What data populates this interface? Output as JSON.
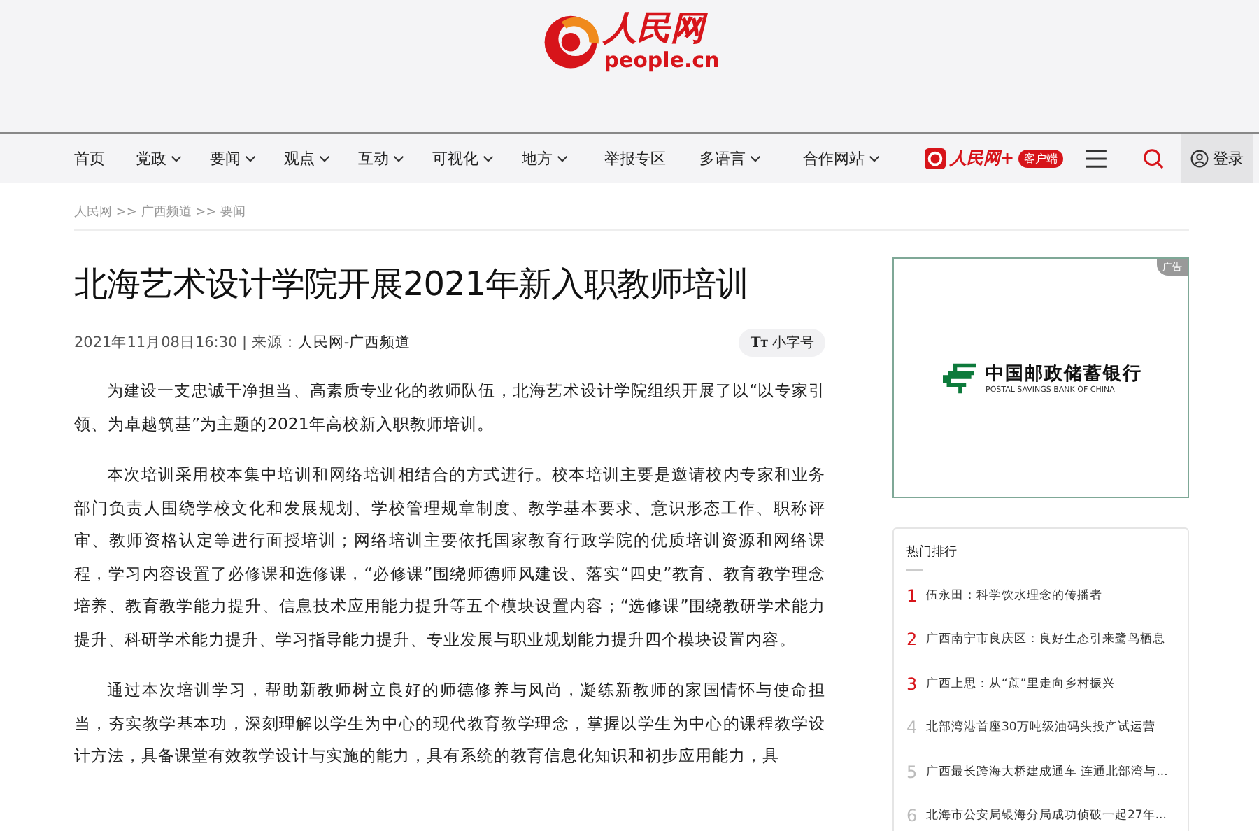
{
  "logo": {
    "name": "人民网",
    "domain": "people.cn"
  },
  "nav": {
    "items": [
      {
        "label": "首页",
        "dropdown": false
      },
      {
        "label": "党政",
        "dropdown": true
      },
      {
        "label": "要闻",
        "dropdown": true
      },
      {
        "label": "观点",
        "dropdown": true
      },
      {
        "label": "互动",
        "dropdown": true
      },
      {
        "label": "可视化",
        "dropdown": true
      },
      {
        "label": "地方",
        "dropdown": true
      },
      {
        "label": "举报专区",
        "dropdown": false
      },
      {
        "label": "多语言",
        "dropdown": true
      },
      {
        "label": "合作网站",
        "dropdown": true
      }
    ],
    "app": {
      "name": "人民网+",
      "badge": "客户端"
    },
    "login": "登录"
  },
  "breadcrumb": "人民网 >> 广西频道 >> 要闻",
  "article": {
    "title": "北海艺术设计学院开展2021年新入职教师培训",
    "meta": "2021年11月08日16:30 | 来源：",
    "source": "人民网-广西频道",
    "font_icon": {
      "big": "T",
      "small": "T"
    },
    "font_button": "小字号",
    "paragraphs": [
      "为建设一支忠诚干净担当、高素质专业化的教师队伍，北海艺术设计学院组织开展了以“以专家引领、为卓越筑基”为主题的2021年高校新入职教师培训。",
      "本次培训采用校本集中培训和网络培训相结合的方式进行。校本培训主要是邀请校内专家和业务部门负责人围绕学校文化和发展规划、学校管理规章制度、教学基本要求、意识形态工作、职称评审、教师资格认定等进行面授培训；网络培训主要依托国家教育行政学院的优质培训资源和网络课程，学习内容设置了必修课和选修课，“必修课”围绕师德师风建设、落实“四史”教育、教育教学理念培养、教育教学能力提升、信息技术应用能力提升等五个模块设置内容；“选修课”围绕教研学术能力提升、科研学术能力提升、学习指导能力提升、专业发展与职业规划能力提升四个模块设置内容。",
      "通过本次培训学习，帮助新教师树立良好的师德修养与风尚，凝练新教师的家国情怀与使命担当，夯实教学基本功，深刻理解以学生为中心的现代教育教学理念，掌握以学生为中心的课程教学设计方法，具备课堂有效教学设计与实施的能力，具有系统的教育信息化知识和初步应用能力，具"
    ]
  },
  "ad": {
    "label": "广告",
    "bank_name": "中国邮政储蓄银行",
    "bank_name_en": "POSTAL SAVINGS BANK OF CHINA"
  },
  "ranking": {
    "title": "热门排行",
    "items": [
      {
        "rank": "1",
        "text": "伍永田：科学饮水理念的传播者",
        "highlighted": true
      },
      {
        "rank": "2",
        "text": "广西南宁市良庆区：良好生态引来鹭鸟栖息",
        "highlighted": true
      },
      {
        "rank": "3",
        "text": "广西上思：从“蔗”里走向乡村振兴",
        "highlighted": true
      },
      {
        "rank": "4",
        "text": "北部湾港首座30万吨级油码头投产试运营",
        "highlighted": false
      },
      {
        "rank": "5",
        "text": "广西最长跨海大桥建成通车 连通北部湾与...",
        "highlighted": false
      },
      {
        "rank": "6",
        "text": "北海市公安局银海分局成功侦破一起27年...",
        "highlighted": false
      }
    ]
  }
}
